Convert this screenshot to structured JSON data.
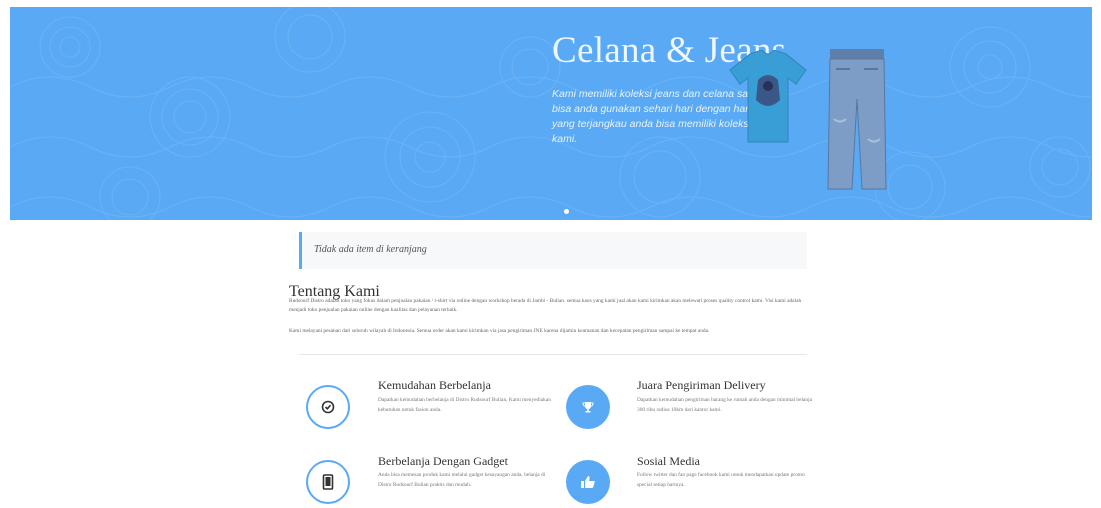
{
  "hero": {
    "title": "Celana & Jeans",
    "text": "Kami memiliki koleksi jeans dan celana santai bisa anda gunakan sehari hari dengan harga yang terjangkau anda bisa memiliki koleksi kami.",
    "bg_color": "#5aa9f5"
  },
  "cart": {
    "note": "Tidak ada item di keranjang"
  },
  "about": {
    "title": "Tentang Kami",
    "p1": "Rudsourf Distro adalah toko yang fokus dalam penjualan pakaian / t-shirt via online dengan workshop berada di Jambi - Bulian. semua kaos yang kami jual akan kami kirimkan akan melewati proses quality control kami. Visi kami adalah menjadi toko penjualan pakaian online dengan kualitas dan pelayanan terbaik.",
    "p2": "Kami melayani pesanan dari seluruh wilayah di Indonesia. Semua order akan kami kirimkan via jasa pengiriman JNE karena dijamin keamanan dan kecepatan pengiriman sampai ke tempat anda."
  },
  "features": [
    {
      "icon": "check-circle-icon",
      "title": "Kemudahan Berbelanja",
      "text": "Dapatkan kemudahan berbelanja di Distro Rudsourf Bulian, Kami menyediakan kebutuhan untuk fasion anda."
    },
    {
      "icon": "trophy-icon",
      "title": "Juara Pengiriman Delivery",
      "text": "Dapatkan kemudahan pengiriman barang ke rumah anda dengan minimal belanja 300 ribu radius 10km dari kantor kami."
    },
    {
      "icon": "tablet-icon",
      "title": "Berbelanja Dengan Gadget",
      "text": "Anda bisa memesan produk kami melalui gadget kesayangan anda, belanja di Distro Rudsourf Bulian praktis dan mudah."
    },
    {
      "icon": "thumbs-up-icon",
      "title": "Sosial Media",
      "text": "Follow twitter dan fan page facebook kami untuk mendapatkan update promo special setiap harinya."
    }
  ]
}
